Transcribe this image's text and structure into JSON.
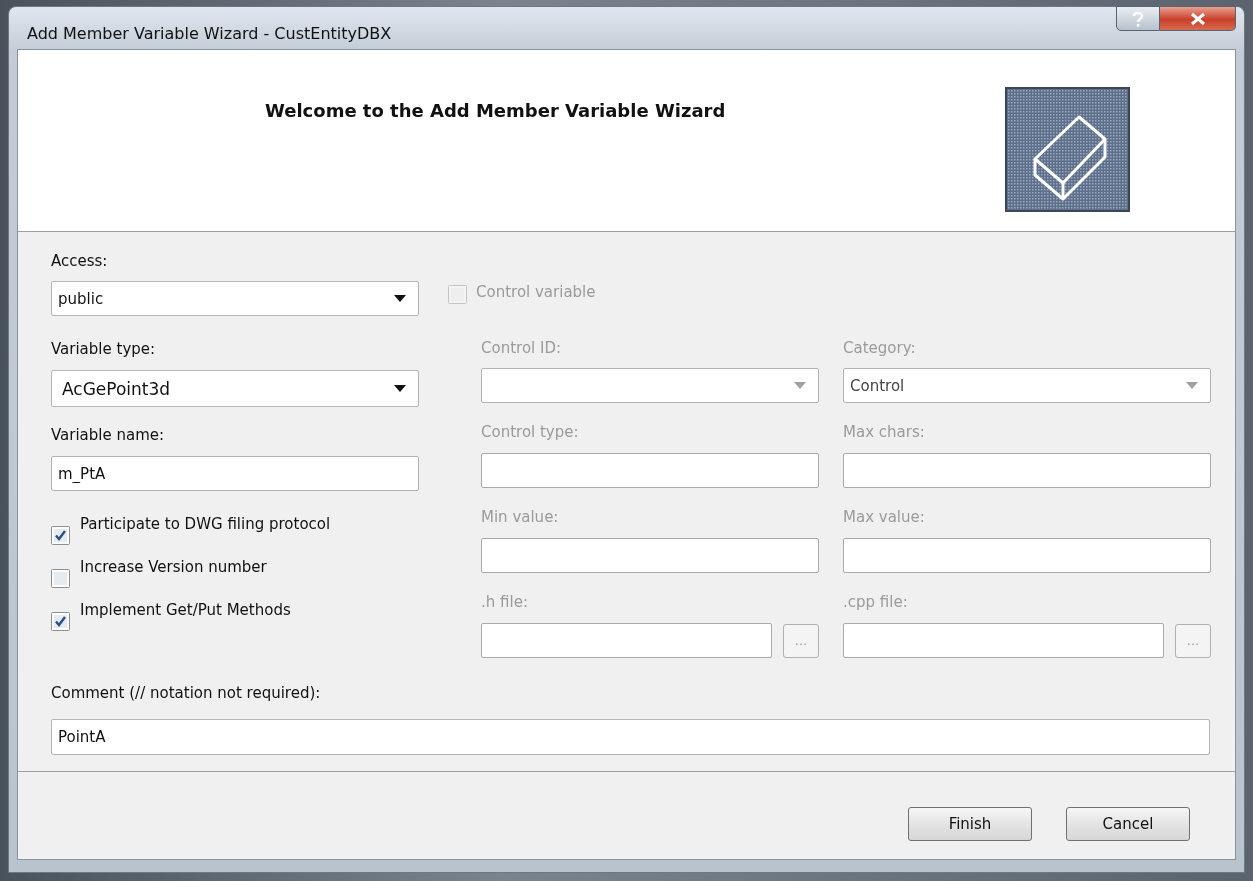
{
  "window": {
    "title": "Add Member Variable Wizard - CustEntityDBX",
    "caption_buttons": [
      {
        "kind": "help"
      },
      {
        "kind": "close"
      }
    ]
  },
  "header": {
    "title": "Welcome to the Add Member Variable Wizard"
  },
  "left_fields": [
    {
      "kind": "combo",
      "label": "Access:",
      "value": "public"
    },
    {
      "kind": "combo",
      "label": "Variable type:",
      "value": "AcGePoint3d"
    },
    {
      "kind": "text",
      "label": "Variable name:",
      "value": "m_PtA"
    }
  ],
  "options": [
    {
      "label": "Participate to DWG filing protocol",
      "checked": true
    },
    {
      "label": "Increase Version number",
      "checked": false
    },
    {
      "label": "Implement Get/Put Methods",
      "checked": true
    }
  ],
  "control_variable": {
    "label": "Control variable",
    "checked": false,
    "disabled": true
  },
  "control_fields": [
    {
      "kind": "combo",
      "label": "Control ID:",
      "disabled": true
    },
    {
      "kind": "combo",
      "label": "Category:",
      "value": "Control",
      "disabled": true
    },
    {
      "kind": "text",
      "label": "Control type:",
      "disabled": true
    },
    {
      "kind": "text",
      "label": "Max chars:",
      "disabled": true
    },
    {
      "kind": "text",
      "label": "Min value:",
      "disabled": true
    },
    {
      "kind": "text",
      "label": "Max value:",
      "disabled": true
    },
    {
      "kind": "file",
      "label": ".h file:",
      "browse": "...",
      "disabled": true
    },
    {
      "kind": "file",
      "label": ".cpp file:",
      "browse": "...",
      "disabled": true
    }
  ],
  "comment": {
    "label": "Comment (// notation not required):",
    "value": "PointA"
  },
  "buttons": [
    {
      "label": "Finish"
    },
    {
      "label": "Cancel"
    }
  ]
}
